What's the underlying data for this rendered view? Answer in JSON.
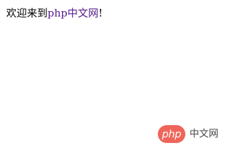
{
  "welcome": {
    "prefix": "欢迎来到",
    "link_text": "php中文网",
    "suffix": "!",
    "link_color": "#551a8b"
  },
  "watermark": {
    "logo_text": "php",
    "site_name": "中文网",
    "logo_color": "#f0655a"
  }
}
